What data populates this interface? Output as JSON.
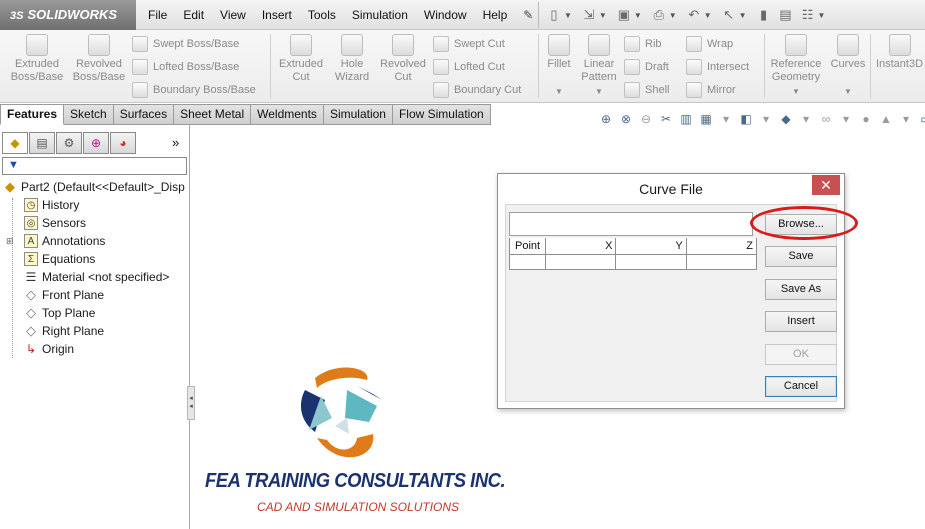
{
  "app": {
    "logo_text": "SOLIDWORKS",
    "logo_prefix": "3S"
  },
  "menu": {
    "items": [
      "File",
      "Edit",
      "View",
      "Insert",
      "Tools",
      "Simulation",
      "Window",
      "Help"
    ],
    "pin_icon": "pushpin-icon"
  },
  "quick_access": [
    "new-document-icon",
    "open-icon",
    "save-icon",
    "print-icon",
    "undo-icon",
    "select-icon",
    "rebuild-icon",
    "file-properties-icon",
    "options-icon"
  ],
  "ribbon": {
    "extruded_boss": "Extruded\nBoss/Base",
    "revolved_boss": "Revolved\nBoss/Base",
    "swept_boss": "Swept Boss/Base",
    "lofted_boss": "Lofted Boss/Base",
    "boundary_boss": "Boundary Boss/Base",
    "extruded_cut": "Extruded\nCut",
    "hole_wizard": "Hole\nWizard",
    "revolved_cut": "Revolved\nCut",
    "swept_cut": "Swept Cut",
    "lofted_cut": "Lofted Cut",
    "boundary_cut": "Boundary Cut",
    "fillet": "Fillet",
    "linear_pattern": "Linear\nPattern",
    "rib": "Rib",
    "draft": "Draft",
    "shell": "Shell",
    "wrap": "Wrap",
    "intersect": "Intersect",
    "mirror": "Mirror",
    "reference_geometry": "Reference\nGeometry",
    "curves": "Curves",
    "instant3d": "Instant3D"
  },
  "tabs": [
    "Features",
    "Sketch",
    "Surfaces",
    "Sheet Metal",
    "Weldments",
    "Simulation",
    "Flow Simulation"
  ],
  "active_tab": "Features",
  "feature_tree": {
    "root": "Part2  (Default<<Default>_Disp",
    "items": [
      {
        "label": "History",
        "icon": "history-icon"
      },
      {
        "label": "Sensors",
        "icon": "sensors-icon"
      },
      {
        "label": "Annotations",
        "icon": "annotations-icon"
      },
      {
        "label": "Equations",
        "icon": "equations-icon"
      },
      {
        "label": "Material <not specified>",
        "icon": "material-icon"
      },
      {
        "label": "Front Plane",
        "icon": "plane-icon"
      },
      {
        "label": "Top Plane",
        "icon": "plane-icon"
      },
      {
        "label": "Right Plane",
        "icon": "plane-icon"
      },
      {
        "label": "Origin",
        "icon": "origin-icon"
      }
    ]
  },
  "branding": {
    "title": "FEA TRAINING  CONSULTANTS  INC.",
    "subtitle": "CAD AND SIMULATION SOLUTIONS",
    "colors": {
      "orange": "#e07b1a",
      "blue": "#1b3270",
      "teal": "#5fb7c2",
      "red": "#c0392b"
    }
  },
  "dialog": {
    "title": "Curve File",
    "path_value": "",
    "columns": [
      "Point",
      "X",
      "Y",
      "Z"
    ],
    "buttons": {
      "browse": "Browse...",
      "save": "Save",
      "save_as": "Save As",
      "insert": "Insert",
      "ok": "OK",
      "cancel": "Cancel"
    }
  },
  "colors": {
    "close_button": "#c75050",
    "highlight": "#d81c1c",
    "default_button": "#3c7fb1"
  }
}
